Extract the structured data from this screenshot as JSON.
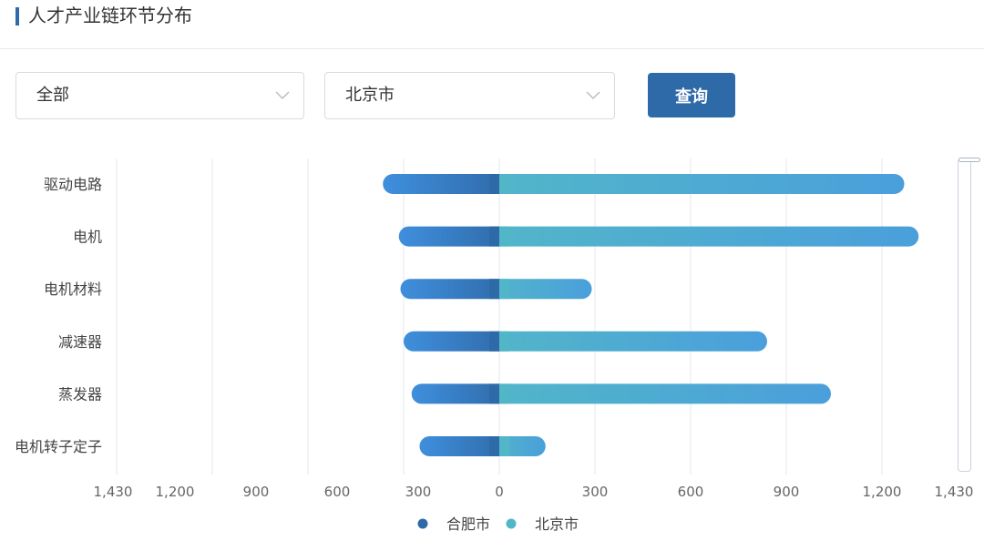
{
  "header": {
    "title": "人才产业链环节分布"
  },
  "filters": {
    "category": {
      "value": "全部"
    },
    "city": {
      "value": "北京市"
    },
    "query_label": "查询"
  },
  "colors": {
    "left_series_start": "#3f8fdd",
    "left_series_end": "#2f6aa8",
    "right_series_start": "#52b6c9",
    "right_series_end": "#4a9fdb",
    "grid": "#e3e7ee",
    "axis_text": "#666666"
  },
  "chart_data": {
    "type": "bar",
    "orientation": "horizontal-butterfly",
    "categories": [
      "驱动电路",
      "电机",
      "电机材料",
      "减速器",
      "蒸发器",
      "电机转子定子"
    ],
    "series": [
      {
        "name": "合肥市",
        "side": "left",
        "values": [
          365,
          315,
          310,
          300,
          275,
          250
        ]
      },
      {
        "name": "北京市",
        "side": "right",
        "values": [
          1270,
          1315,
          290,
          840,
          1040,
          145
        ]
      }
    ],
    "left_ticks": [
      "1,430",
      "1,200",
      "900",
      "600",
      "300",
      "0"
    ],
    "right_ticks": [
      "300",
      "600",
      "900",
      "1,200",
      "1,430"
    ],
    "xlim": [
      -1430,
      1430
    ],
    "grid": true,
    "legend_position": "bottom-center"
  }
}
